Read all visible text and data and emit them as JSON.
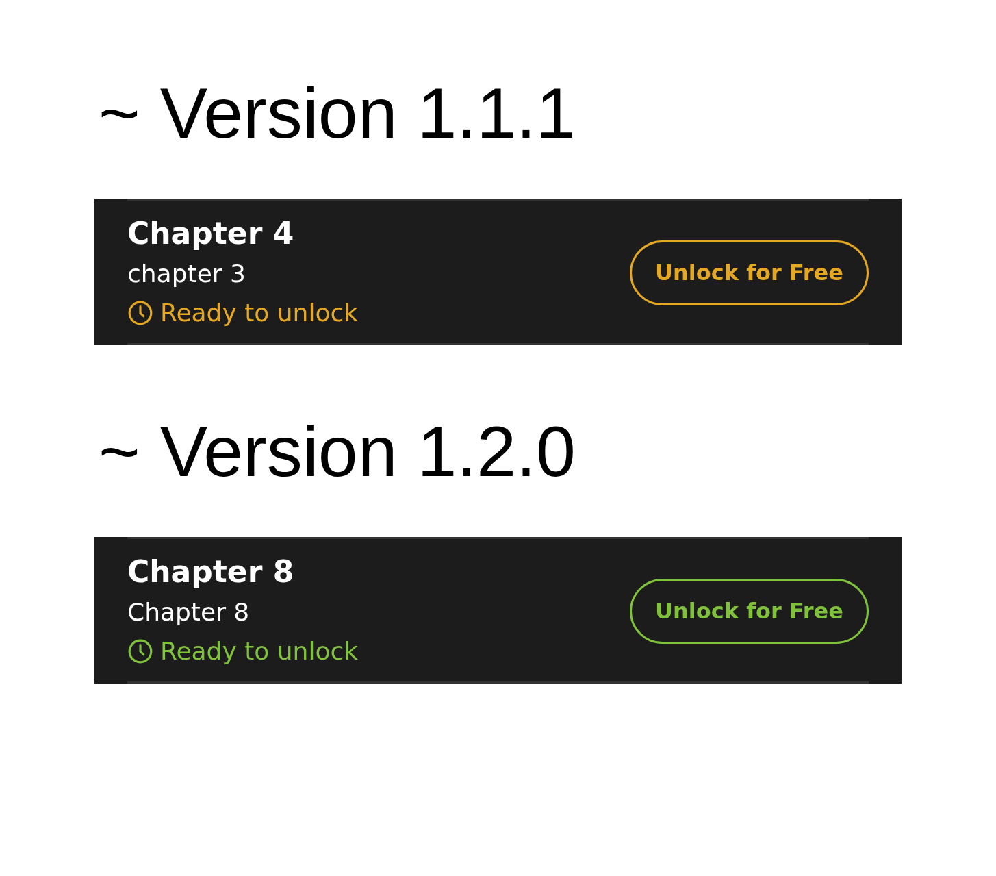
{
  "sections": [
    {
      "heading": "~ Version 1.1.1",
      "card": {
        "title": "Chapter 4",
        "subtitle": "chapter 3",
        "status": "Ready to unlock",
        "button": "Unlock for Free",
        "color": "#e5a823"
      }
    },
    {
      "heading": "~ Version 1.2.0",
      "card": {
        "title": "Chapter 8",
        "subtitle": "Chapter 8",
        "status": "Ready to unlock",
        "button": "Unlock for Free",
        "color": "#80c23c"
      }
    }
  ]
}
